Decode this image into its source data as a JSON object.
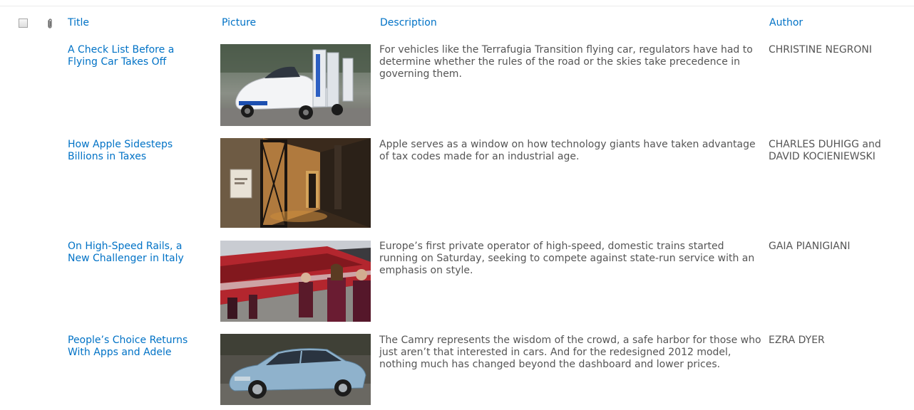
{
  "header": {
    "title": "Title",
    "picture": "Picture",
    "description": "Description",
    "author": "Author"
  },
  "rows": [
    {
      "title": "A Check List Before a Flying Car Takes Off",
      "description": "For vehicles like the Terrafugia Transition flying car, regulators have had to determine whether the rules of the road or the skies take precedence in governing them.",
      "author": "CHRISTINE NEGRONI",
      "picture_icon": "flying-car-photo"
    },
    {
      "title": "How Apple Sidesteps Billions in Taxes",
      "description": "Apple serves as a window on how technology giants have taken advantage of tax codes made for an industrial age.",
      "author": "CHARLES DUHIGG and DAVID KOCIENIEWSKI",
      "picture_icon": "office-hallway-photo"
    },
    {
      "title": "On High-Speed Rails, a New Challenger in Italy",
      "description": "Europe’s first private operator of high-speed, domestic trains started running on Saturday, seeking to compete against state-run service with an emphasis on style.",
      "author": "GAIA PIANIGIANI",
      "picture_icon": "train-platform-photo"
    },
    {
      "title": "People’s Choice Returns With Apps and Adele",
      "description": "The Camry represents the wisdom of the crowd, a safe harbor for those who just aren’t that interested in cars. And for the redesigned 2012 model, nothing much has changed beyond the dashboard and lower prices.",
      "author": "EZRA DYER",
      "picture_icon": "sedan-car-photo"
    }
  ]
}
